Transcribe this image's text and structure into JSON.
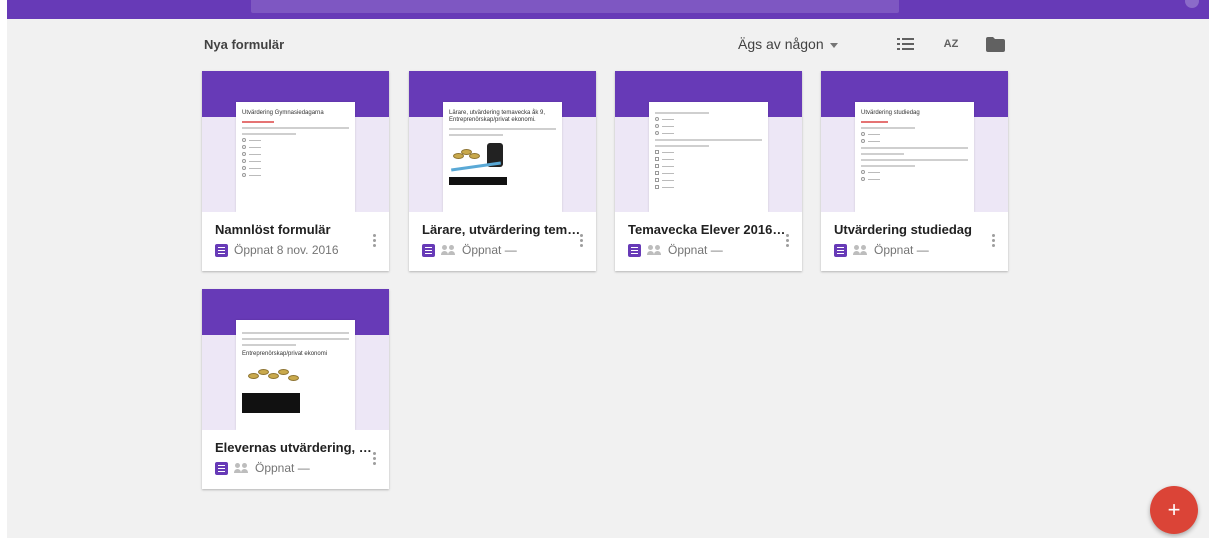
{
  "header": {
    "section_title": "Nya formulär",
    "owner_filter": "Ägs av någon",
    "sort_label": "AZ"
  },
  "colors": {
    "brand": "#673ab7",
    "fab": "#db4437"
  },
  "cards": [
    {
      "title": "Namnlöst formulär",
      "meta": "Öppnat 8 nov. 2016",
      "shared": false,
      "thumb_title": "Utvärdering Gymnasiedagarna"
    },
    {
      "title": "Lärare, utvärdering temav...",
      "meta": "Öppnat —",
      "shared": true,
      "thumb_title": "Lärare, utvärdering temavecka åk 9, Entreprenörskap/privat ekonomi."
    },
    {
      "title": "Temavecka Elever 2016 å...",
      "meta": "Öppnat —",
      "shared": true,
      "thumb_title": ""
    },
    {
      "title": "Utvärdering studiedag",
      "meta": "Öppnat —",
      "shared": true,
      "thumb_title": "Utvärdering studiedag"
    },
    {
      "title": "Elevernas utvärdering, Te...",
      "meta": "Öppnat —",
      "shared": true,
      "thumb_title": "Entreprenörskap/privat ekonomi"
    }
  ],
  "fab": {
    "label": "+"
  },
  "icons": {
    "list": "list-view-icon",
    "sort": "sort-az-icon",
    "folder": "folder-icon",
    "form": "form-icon",
    "shared": "people-icon",
    "more": "more-vert-icon"
  }
}
